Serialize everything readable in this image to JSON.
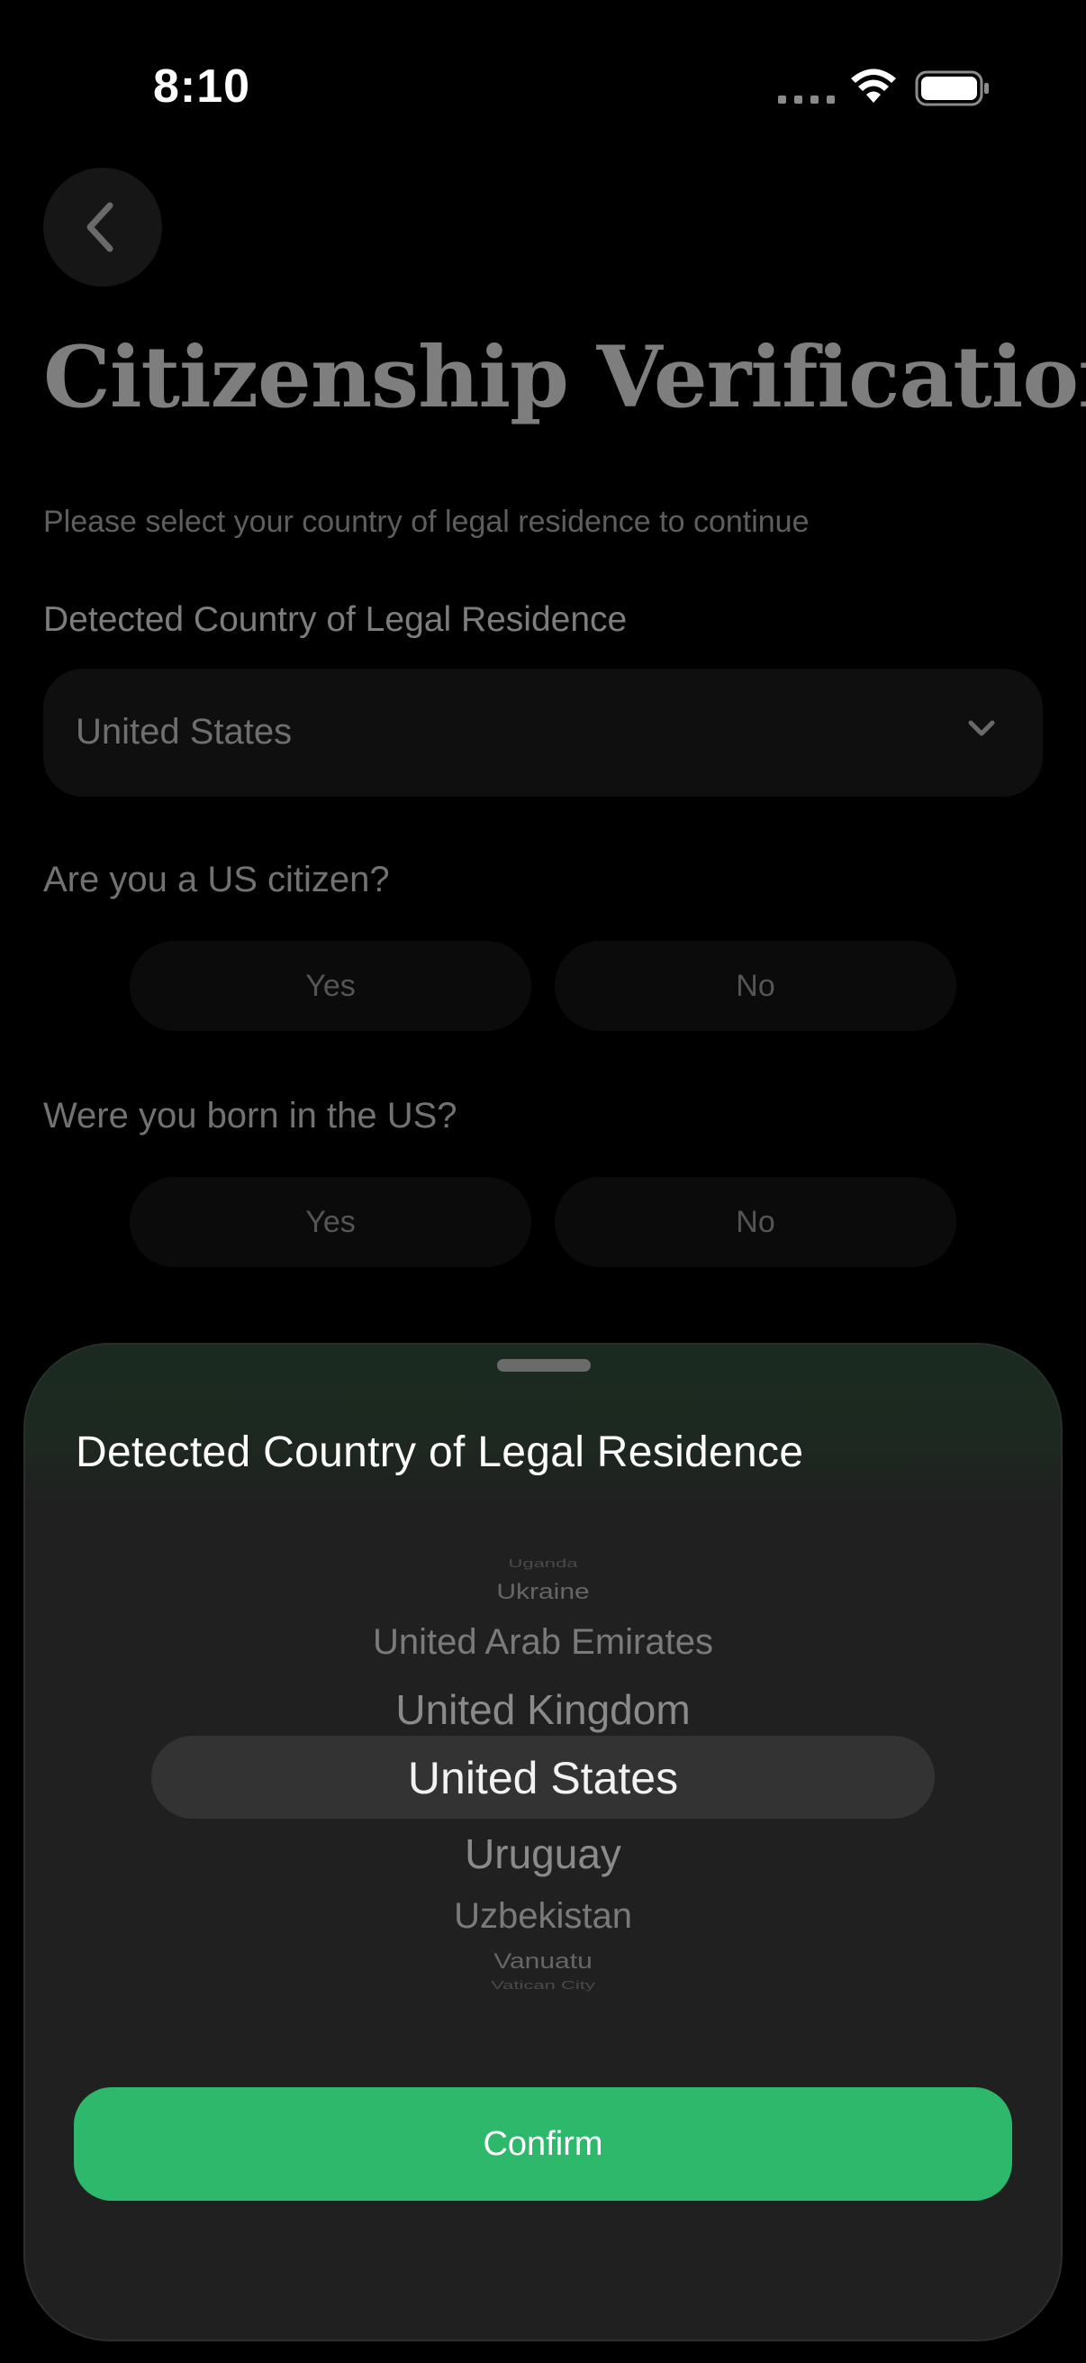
{
  "status_bar": {
    "time": "8:10",
    "icons": [
      "signal-icon",
      "wifi-icon",
      "battery-icon"
    ]
  },
  "header": {
    "back_icon": "chevron-left-icon",
    "title": "Citizenship Verification",
    "subtitle": "Please select your country of legal residence to continue"
  },
  "form": {
    "country_label": "Detected Country of Legal Residence",
    "country_value": "United States",
    "q1": {
      "label": "Are you a US citizen?",
      "yes": "Yes",
      "no": "No"
    },
    "q2": {
      "label": "Were you born in the US?",
      "yes": "Yes",
      "no": "No"
    }
  },
  "sheet": {
    "title": "Detected Country of Legal Residence",
    "picker_items": [
      "Uganda",
      "Ukraine",
      "United Arab Emirates",
      "United Kingdom",
      "United States",
      "Uruguay",
      "Uzbekistan",
      "Vanuatu",
      "Vatican City"
    ],
    "selected": "United States",
    "confirm_label": "Confirm"
  },
  "colors": {
    "background": "#000000",
    "sheet": "#202020",
    "accent": "#2db86b"
  }
}
